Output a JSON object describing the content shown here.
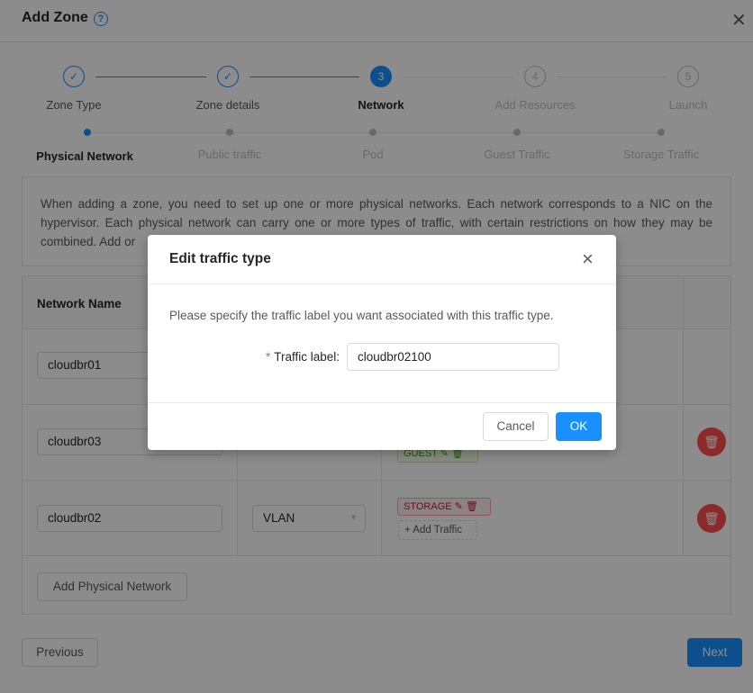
{
  "header": {
    "title": "Add Zone",
    "help_icon": "question-circle-icon",
    "close_icon": "close-icon"
  },
  "steps": [
    {
      "label": "Zone Type",
      "state": "done",
      "icon": "check-icon",
      "glyph": "✓"
    },
    {
      "label": "Zone details",
      "state": "done",
      "icon": "check-icon",
      "glyph": "✓"
    },
    {
      "label": "Network",
      "state": "current",
      "number": "3"
    },
    {
      "label": "Add Resources",
      "state": "wait",
      "number": "4"
    },
    {
      "label": "Launch",
      "state": "wait",
      "number": "5"
    }
  ],
  "substeps": [
    {
      "label": "Physical Network",
      "active": true
    },
    {
      "label": "Public traffic",
      "active": false
    },
    {
      "label": "Pod",
      "active": false
    },
    {
      "label": "Guest Traffic",
      "active": false
    },
    {
      "label": "Storage Traffic",
      "active": false
    }
  ],
  "description": "When adding a zone, you need to set up one or more physical networks. Each network corresponds to a NIC on the hypervisor. Each physical network can carry one or more types of traffic, with certain restrictions on how they may be combined. Add or ",
  "table": {
    "header": {
      "network_name": "Network Name"
    },
    "rows": [
      {
        "name": "cloudbr01"
      },
      {
        "name": "cloudbr03",
        "tags": [
          "GUEST"
        ]
      },
      {
        "name": "cloudbr02",
        "isolation": "VLAN",
        "tags": [
          "STORAGE"
        ],
        "add_traffic": "+ Add Traffic"
      }
    ],
    "add_physical_network": "Add Physical Network"
  },
  "footer": {
    "previous": "Previous",
    "next": "Next"
  },
  "modal": {
    "title": "Edit traffic type",
    "close_glyph": "×",
    "description": "Please specify the traffic label you want associated with this traffic type.",
    "field_label": "Traffic label:",
    "required_mark": "*",
    "field_value": "cloudbr02100",
    "cancel": "Cancel",
    "ok": "OK"
  },
  "colors": {
    "primary": "#1890ff",
    "danger": "#ff4d4f",
    "mask": "rgba(0,0,0,0.45)"
  }
}
